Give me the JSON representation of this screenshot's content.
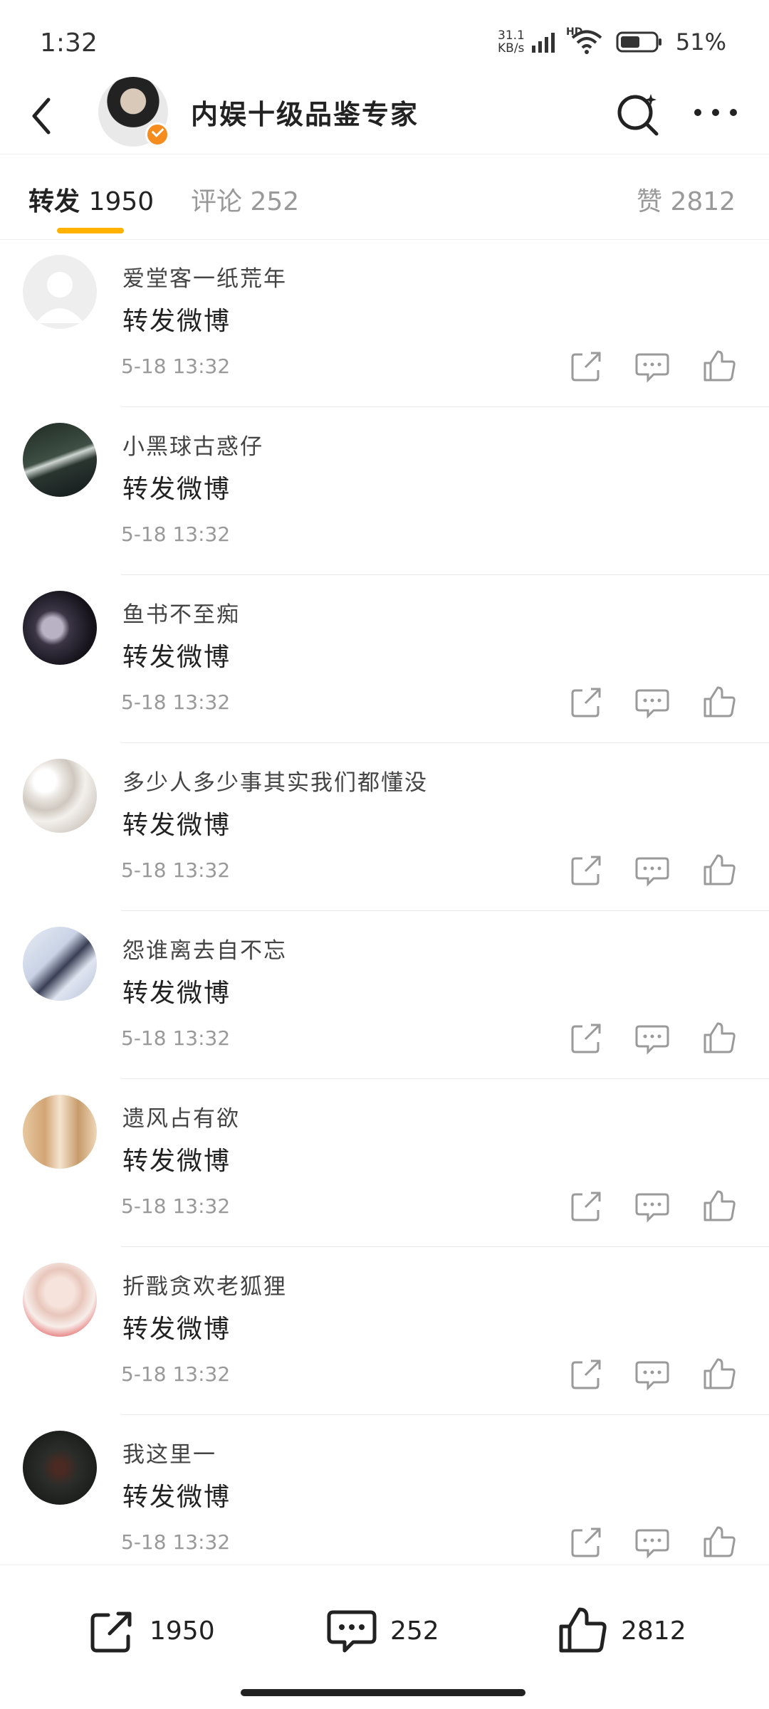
{
  "status_bar": {
    "time": "1:32",
    "speed_value": "31.1",
    "speed_unit": "KB/s",
    "network": "HD",
    "battery": "51%"
  },
  "header": {
    "title": "内娱十级品鉴专家",
    "icons": [
      "back-icon",
      "search-icon",
      "more-icon"
    ],
    "badge_color": "#f68b1e"
  },
  "tabs": [
    {
      "label": "转发",
      "count": "1950"
    },
    {
      "label": "评论",
      "count": "252"
    },
    {
      "label": "赞",
      "count": "2812"
    }
  ],
  "accent_color": "#ffb300",
  "reposts": [
    {
      "user": "爱堂客一纸荒年",
      "content": "转发微博",
      "time": "5-18 13:32"
    },
    {
      "user": "小黑球古惑仔",
      "content": "转发微博",
      "time": "5-18 13:32"
    },
    {
      "user": "鱼书不至痴",
      "content": "转发微博",
      "time": "5-18 13:32"
    },
    {
      "user": "多少人多少事其实我们都懂没",
      "content": "转发微博",
      "time": "5-18 13:32"
    },
    {
      "user": "怨谁离去自不忘",
      "content": "转发微博",
      "time": "5-18 13:32"
    },
    {
      "user": "遗风占有欲",
      "content": "转发微博",
      "time": "5-18 13:32"
    },
    {
      "user": "折戬贪欢老狐狸",
      "content": "转发微博",
      "time": "5-18 13:32"
    },
    {
      "user": "我这里一",
      "content": "转发微博",
      "time": "5-18 13:32"
    }
  ],
  "bottom_bar": {
    "repost_count": "1950",
    "comment_count": "252",
    "like_count": "2812"
  }
}
